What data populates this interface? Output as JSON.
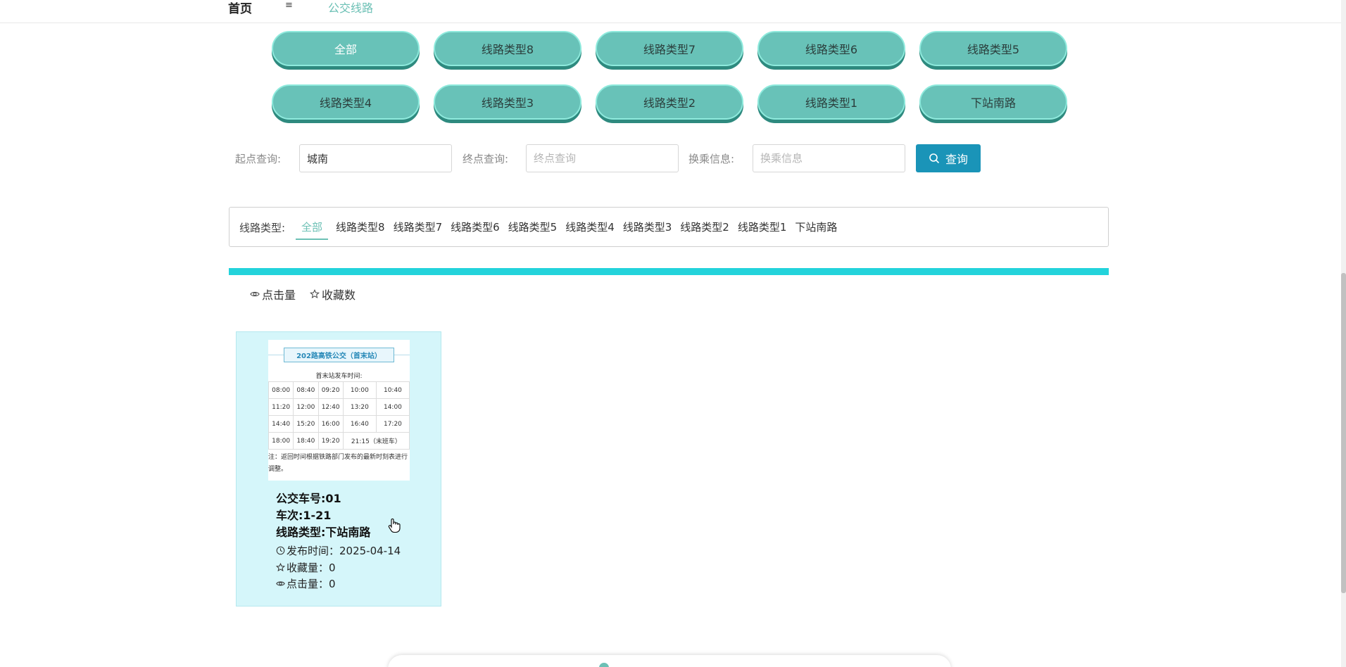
{
  "topbar": {
    "home": "首页",
    "menu_icon": "≡",
    "crumb": "公交线路"
  },
  "categories": [
    "全部",
    "线路类型8",
    "线路类型7",
    "线路类型6",
    "线路类型5",
    "线路类型4",
    "线路类型3",
    "线路类型2",
    "线路类型1",
    "下站南路"
  ],
  "active_category": "全部",
  "search": {
    "start_label": "起点查询:",
    "start_value": "城南",
    "end_label": "终点查询:",
    "end_placeholder": "终点查询",
    "transfer_label": "换乘信息:",
    "transfer_placeholder": "换乘信息",
    "button": "查询"
  },
  "filter": {
    "label": "线路类型:",
    "tags": [
      "全部",
      "线路类型8",
      "线路类型7",
      "线路类型6",
      "线路类型5",
      "线路类型4",
      "线路类型3",
      "线路类型2",
      "线路类型1",
      "下站南路"
    ],
    "active": "全部"
  },
  "sort": {
    "clicks": "点击量",
    "favorites": "收藏数"
  },
  "card": {
    "image": {
      "title": "202路高铁公交（首末站）",
      "subtitle": "首末站发车时间:",
      "rows": [
        [
          "08:00",
          "08:40",
          "09:20",
          "10:00",
          "10:40"
        ],
        [
          "11:20",
          "12:00",
          "12:40",
          "13:20",
          "14:00"
        ],
        [
          "14:40",
          "15:20",
          "16:00",
          "16:40",
          "17:20"
        ],
        [
          "18:00",
          "18:40",
          "19:20",
          "21:15（末班车）"
        ]
      ],
      "note": "注：返回时间根据铁路部门发布的最新时刻表进行调整。"
    },
    "bus_no": "公交车号:01",
    "trip": "车次:1-21",
    "route_type": "线路类型:下站南路",
    "publish_time": "发布时间：2025-04-14",
    "favorites": "收藏量：0",
    "clicks": "点击量：0"
  },
  "colors": {
    "accent": "#6cc0b5",
    "pill": "#68c2b8",
    "button": "#1a94b8",
    "bar": "#23d3db",
    "card": "#d5f6fa"
  }
}
